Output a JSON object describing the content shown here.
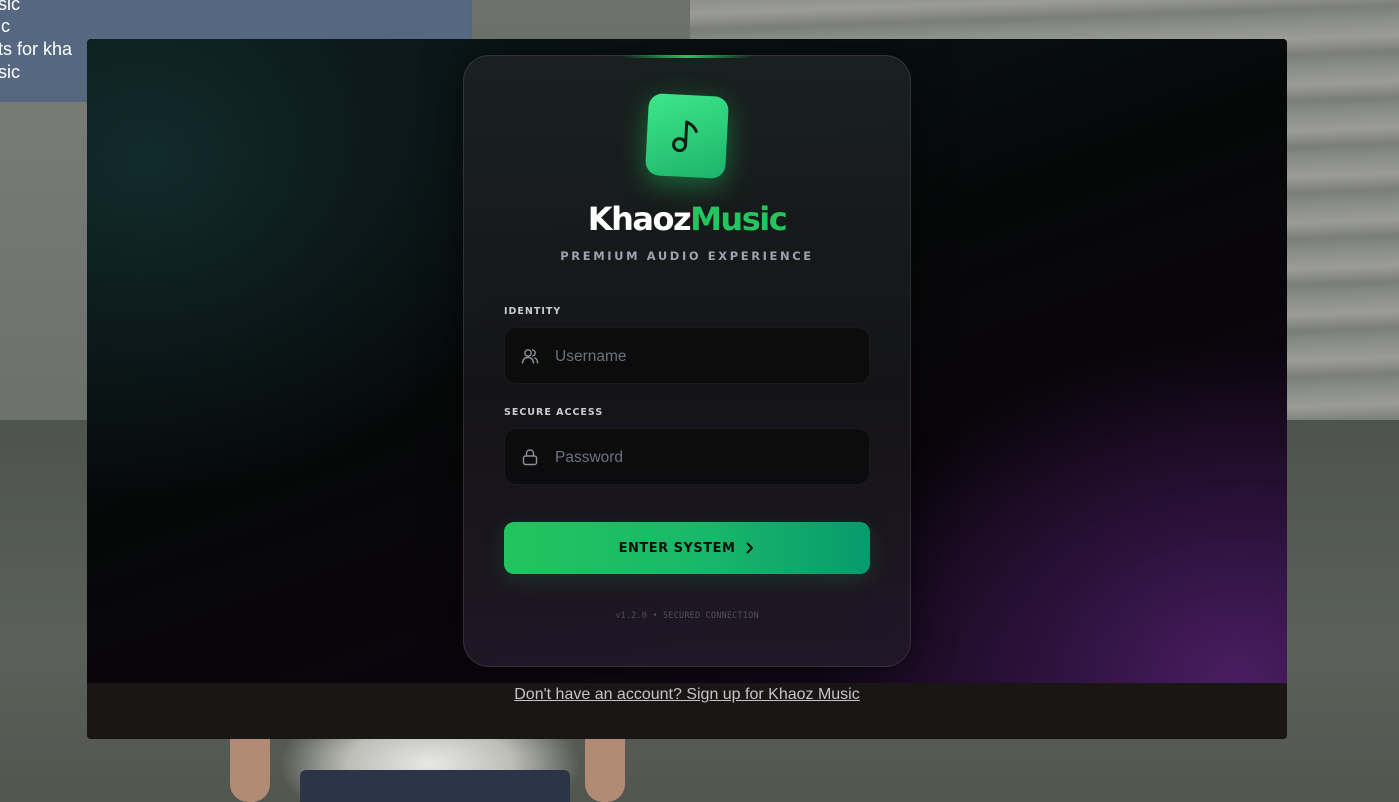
{
  "notification": {
    "lines": [
      "usic",
      "sic",
      "nts for kha",
      "usic"
    ]
  },
  "login": {
    "brand_part1": "Khaoz",
    "brand_part2": "Music",
    "tagline": "PREMIUM AUDIO EXPERIENCE",
    "identity_label": "IDENTITY",
    "username_placeholder": "Username",
    "secure_label": "SECURE ACCESS",
    "password_placeholder": "Password",
    "enter_label": "ENTER SYSTEM",
    "version": "v1.2.0 • SECURED CONNECTION",
    "signup_link": "Don't have an account? Sign up for Khaoz Music"
  },
  "icons": {
    "logo": "music-note-icon",
    "username": "users-icon",
    "password": "lock-icon",
    "enter": "chevron-right-icon"
  },
  "colors": {
    "accent": "#22c55e",
    "accent_dark": "#089a6c",
    "card_bg": "#1c2222",
    "text_muted": "#9ca3af"
  }
}
